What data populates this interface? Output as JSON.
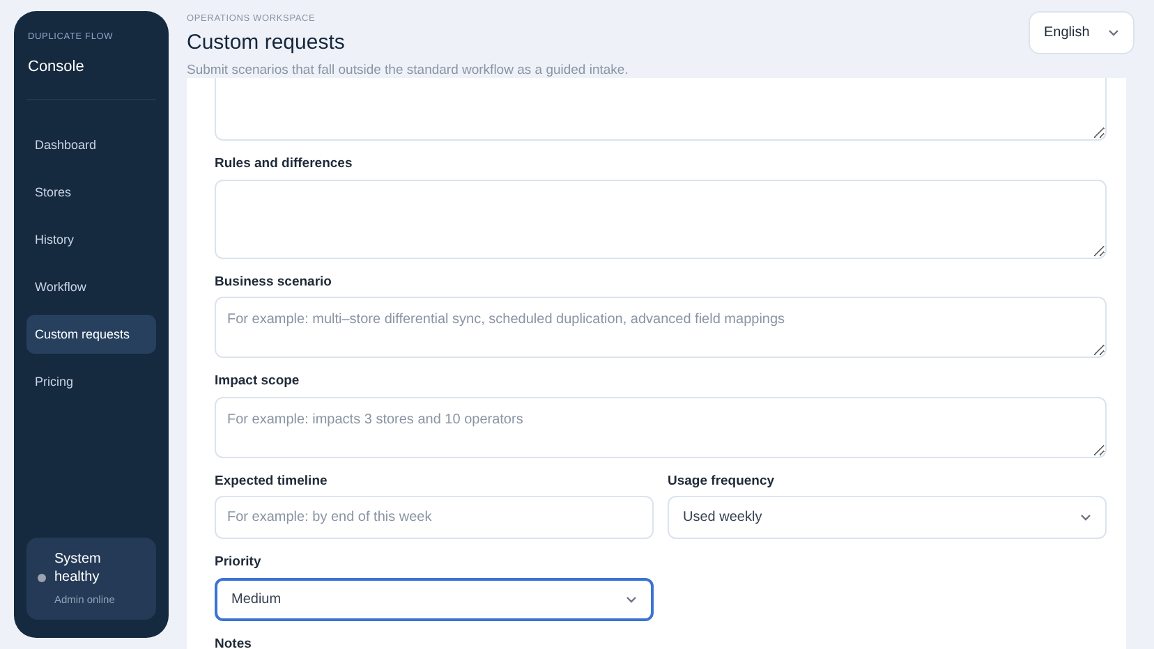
{
  "sidebar": {
    "eyebrow": "DUPLICATE FLOW",
    "title": "Console",
    "items": [
      {
        "label": "Dashboard",
        "selected": false
      },
      {
        "label": "Stores",
        "selected": false
      },
      {
        "label": "History",
        "selected": false
      },
      {
        "label": "Workflow",
        "selected": false
      },
      {
        "label": "Custom requests",
        "selected": true
      },
      {
        "label": "Pricing",
        "selected": false
      }
    ],
    "status": {
      "title": "System healthy",
      "subtitle": "Admin online",
      "color": "#9ca3af"
    }
  },
  "header": {
    "eyebrow": "OPERATIONS WORKSPACE",
    "title": "Custom requests",
    "subtitle": "Submit scenarios that fall outside the standard workflow as a guided intake.",
    "language": "English"
  },
  "form": {
    "fields": [
      {
        "kind": "textarea",
        "label": "Rules and differences",
        "focused": false
      },
      {
        "kind": "textarea",
        "label": "Business scenario",
        "placeholder": "For example: multi–store differential sync, scheduled duplication, advanced field mappings",
        "focused": false
      },
      {
        "kind": "textarea",
        "label": "Impact scope",
        "placeholder": "For example: impacts 3 stores and 10 operators",
        "focused": false
      }
    ],
    "row": [
      {
        "kind": "input",
        "label": "Expected timeline",
        "placeholder": "For example: by end of this week",
        "focused": false
      },
      {
        "kind": "select",
        "label": "Usage frequency",
        "value": "Used weekly",
        "focused": false
      }
    ],
    "priority": {
      "kind": "select",
      "label": "Priority",
      "value": "Medium",
      "focused": true
    },
    "notes_label": "Notes"
  }
}
